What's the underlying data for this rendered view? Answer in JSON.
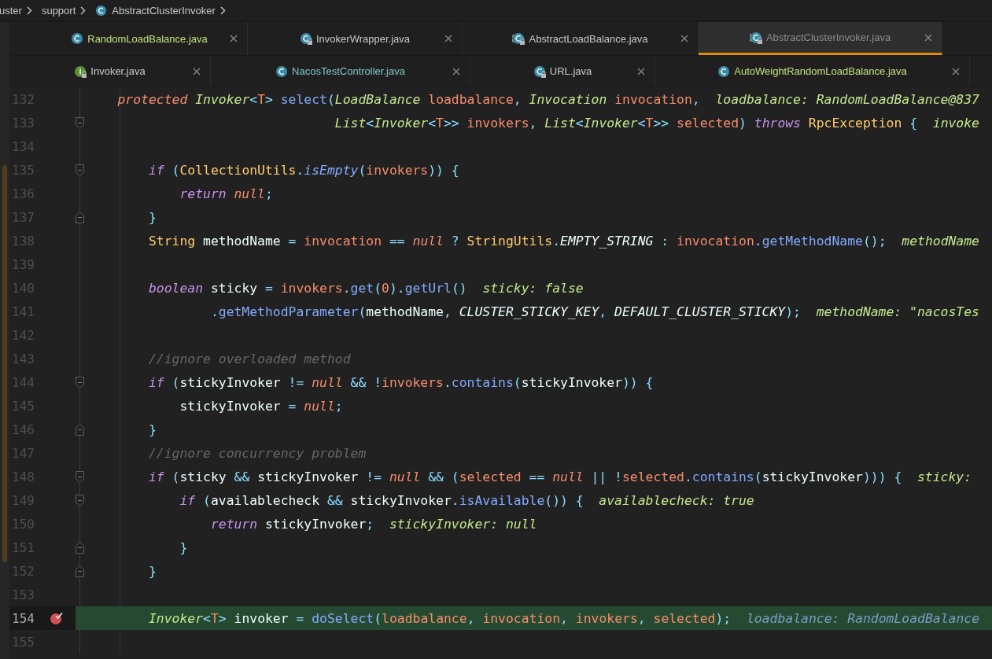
{
  "breadcrumbs": [
    {
      "label": "uster"
    },
    {
      "label": "support"
    },
    {
      "label": "AbstractClusterInvoker",
      "kind": "class"
    }
  ],
  "tab_rows": [
    [
      {
        "label": "RandomLoadBalance.java",
        "kind": "class",
        "locked": false,
        "selected": false,
        "color": "#c5e07c"
      },
      {
        "label": "InvokerWrapper.java",
        "kind": "class",
        "locked": true,
        "selected": false,
        "color": "#c9c9c9"
      },
      {
        "label": "AbstractLoadBalance.java",
        "kind": "abstract",
        "locked": true,
        "selected": false,
        "color": "#c9c9c9"
      },
      {
        "label": "AbstractClusterInvoker.java",
        "kind": "abstract",
        "locked": true,
        "selected": true,
        "color": "#8c8c8c"
      }
    ],
    [
      {
        "label": "Invoker.java",
        "kind": "interface",
        "locked": true,
        "selected": false,
        "color": "#c9c9c9"
      },
      {
        "label": "NacosTestController.java",
        "kind": "class",
        "locked": false,
        "selected": false,
        "color": "#7fc6c6"
      },
      {
        "label": "URL.java",
        "kind": "class",
        "locked": true,
        "selected": false,
        "color": "#c9c9c9"
      },
      {
        "label": "AutoWeightRandomLoadBalance.java",
        "kind": "class",
        "locked": false,
        "selected": false,
        "color": "#c5e07c"
      }
    ]
  ],
  "editor": {
    "lines": [
      {
        "number": "132",
        "current": false,
        "breakpoint": false,
        "code": [
          {
            "kind": "modifier",
            "text": "    protected "
          },
          {
            "kind": "type",
            "text": "Invoker"
          },
          {
            "kind": "punct",
            "text": "<"
          },
          {
            "kind": "type_param",
            "text": "T"
          },
          {
            "kind": "punct",
            "text": "> "
          },
          {
            "kind": "method",
            "text": "select"
          },
          {
            "kind": "punct",
            "text": "("
          },
          {
            "kind": "type",
            "text": "LoadBalance "
          },
          {
            "kind": "param",
            "text": "loadbalance"
          },
          {
            "kind": "punct",
            "text": ", "
          },
          {
            "kind": "type",
            "text": "Invocation "
          },
          {
            "kind": "param",
            "text": "invocation"
          },
          {
            "kind": "punct",
            "text": ","
          }
        ],
        "hint": "loadbalance: RandomLoadBalance@837"
      },
      {
        "number": "133",
        "kind": "fold_start",
        "current": false,
        "breakpoint": false,
        "code": [
          {
            "kind": "type",
            "text": "                                List"
          },
          {
            "kind": "punct",
            "text": "<"
          },
          {
            "kind": "type",
            "text": "Invoker"
          },
          {
            "kind": "punct",
            "text": "<"
          },
          {
            "kind": "type_param",
            "text": "T"
          },
          {
            "kind": "punct",
            "text": ">> "
          },
          {
            "kind": "param",
            "text": "invokers"
          },
          {
            "kind": "punct",
            "text": ", "
          },
          {
            "kind": "type",
            "text": "List"
          },
          {
            "kind": "punct",
            "text": "<"
          },
          {
            "kind": "type",
            "text": "Invoker"
          },
          {
            "kind": "punct",
            "text": "<"
          },
          {
            "kind": "type_param",
            "text": "T"
          },
          {
            "kind": "punct",
            "text": ">> "
          },
          {
            "kind": "param",
            "text": "selected"
          },
          {
            "kind": "punct",
            "text": ") "
          },
          {
            "kind": "keyword",
            "text": "throws "
          },
          {
            "kind": "class",
            "text": "RpcException "
          },
          {
            "kind": "punct",
            "text": "{"
          }
        ],
        "hint": "invoke"
      },
      {
        "number": "134",
        "current": false,
        "breakpoint": false
      },
      {
        "number": "135",
        "kind": "fold_start",
        "current": false,
        "breakpoint": false,
        "code": [
          {
            "kind": "keyword",
            "text": "        if "
          },
          {
            "kind": "punct",
            "text": "("
          },
          {
            "kind": "class",
            "text": "CollectionUtils"
          },
          {
            "kind": "punct",
            "text": "."
          },
          {
            "kind": "static_method",
            "text": "isEmpty"
          },
          {
            "kind": "punct",
            "text": "("
          },
          {
            "kind": "param",
            "text": "invokers"
          },
          {
            "kind": "punct",
            "text": ")) {"
          }
        ]
      },
      {
        "number": "136",
        "current": false,
        "breakpoint": false,
        "code": [
          {
            "kind": "keyword",
            "text": "            return "
          },
          {
            "kind": "literal",
            "text": "null"
          },
          {
            "kind": "punct",
            "text": ";"
          }
        ]
      },
      {
        "number": "137",
        "kind": "fold_end",
        "current": false,
        "breakpoint": false,
        "code": [
          {
            "kind": "punct",
            "text": "        }"
          }
        ]
      },
      {
        "number": "138",
        "current": false,
        "breakpoint": false,
        "code": [
          {
            "kind": "class",
            "text": "        String "
          },
          {
            "kind": "ident",
            "text": "methodName "
          },
          {
            "kind": "punct",
            "text": "= "
          },
          {
            "kind": "param",
            "text": "invocation "
          },
          {
            "kind": "punct",
            "text": "== "
          },
          {
            "kind": "literal",
            "text": "null "
          },
          {
            "kind": "punct",
            "text": "? "
          },
          {
            "kind": "class",
            "text": "StringUtils"
          },
          {
            "kind": "punct",
            "text": "."
          },
          {
            "kind": "constant",
            "text": "EMPTY_STRING "
          },
          {
            "kind": "punct",
            "text": ": "
          },
          {
            "kind": "param",
            "text": "invocation"
          },
          {
            "kind": "punct",
            "text": "."
          },
          {
            "kind": "method",
            "text": "getMethodName"
          },
          {
            "kind": "punct",
            "text": "();"
          }
        ],
        "hint": "methodName"
      },
      {
        "number": "139",
        "current": false,
        "breakpoint": false
      },
      {
        "number": "140",
        "current": false,
        "breakpoint": false,
        "code": [
          {
            "kind": "keyword",
            "text": "        boolean "
          },
          {
            "kind": "ident",
            "text": "sticky "
          },
          {
            "kind": "punct",
            "text": "= "
          },
          {
            "kind": "param",
            "text": "invokers"
          },
          {
            "kind": "punct",
            "text": "."
          },
          {
            "kind": "method",
            "text": "get"
          },
          {
            "kind": "punct",
            "text": "("
          },
          {
            "kind": "number",
            "text": "0"
          },
          {
            "kind": "punct",
            "text": ")."
          },
          {
            "kind": "method",
            "text": "getUrl"
          },
          {
            "kind": "punct",
            "text": "()"
          }
        ],
        "hint": "sticky: false"
      },
      {
        "number": "141",
        "current": false,
        "breakpoint": false,
        "code": [
          {
            "kind": "punct",
            "text": "                ."
          },
          {
            "kind": "method",
            "text": "getMethodParameter"
          },
          {
            "kind": "punct",
            "text": "("
          },
          {
            "kind": "ident",
            "text": "methodName"
          },
          {
            "kind": "punct",
            "text": ", "
          },
          {
            "kind": "constant",
            "text": "CLUSTER_STICKY_KEY"
          },
          {
            "kind": "punct",
            "text": ", "
          },
          {
            "kind": "constant",
            "text": "DEFAULT_CLUSTER_STICKY"
          },
          {
            "kind": "punct",
            "text": ");"
          }
        ],
        "hint": "methodName: \"nacosTes"
      },
      {
        "number": "142",
        "current": false,
        "breakpoint": false
      },
      {
        "number": "143",
        "current": false,
        "breakpoint": false,
        "code": [
          {
            "kind": "comment",
            "text": "        //ignore overloaded method"
          }
        ]
      },
      {
        "number": "144",
        "kind": "fold_start",
        "current": false,
        "breakpoint": false,
        "code": [
          {
            "kind": "keyword",
            "text": "        if "
          },
          {
            "kind": "punct",
            "text": "("
          },
          {
            "kind": "ident",
            "text": "stickyInvoker "
          },
          {
            "kind": "punct",
            "text": "!= "
          },
          {
            "kind": "literal",
            "text": "null "
          },
          {
            "kind": "punct",
            "text": "&& !"
          },
          {
            "kind": "param",
            "text": "invokers"
          },
          {
            "kind": "punct",
            "text": "."
          },
          {
            "kind": "method",
            "text": "contains"
          },
          {
            "kind": "punct",
            "text": "("
          },
          {
            "kind": "ident",
            "text": "stickyInvoker"
          },
          {
            "kind": "punct",
            "text": ")) {"
          }
        ]
      },
      {
        "number": "145",
        "current": false,
        "breakpoint": false,
        "code": [
          {
            "kind": "ident",
            "text": "            stickyInvoker "
          },
          {
            "kind": "punct",
            "text": "= "
          },
          {
            "kind": "literal",
            "text": "null"
          },
          {
            "kind": "punct",
            "text": ";"
          }
        ]
      },
      {
        "number": "146",
        "kind": "fold_end",
        "current": false,
        "breakpoint": false,
        "code": [
          {
            "kind": "punct",
            "text": "        }"
          }
        ]
      },
      {
        "number": "147",
        "current": false,
        "breakpoint": false,
        "code": [
          {
            "kind": "comment",
            "text": "        //ignore concurrency problem"
          }
        ]
      },
      {
        "number": "148",
        "kind": "fold_start",
        "current": false,
        "breakpoint": false,
        "code": [
          {
            "kind": "keyword",
            "text": "        if "
          },
          {
            "kind": "punct",
            "text": "("
          },
          {
            "kind": "ident",
            "text": "sticky "
          },
          {
            "kind": "punct",
            "text": "&& "
          },
          {
            "kind": "ident",
            "text": "stickyInvoker "
          },
          {
            "kind": "punct",
            "text": "!= "
          },
          {
            "kind": "literal",
            "text": "null "
          },
          {
            "kind": "punct",
            "text": "&& ("
          },
          {
            "kind": "param",
            "text": "selected "
          },
          {
            "kind": "punct",
            "text": "== "
          },
          {
            "kind": "literal",
            "text": "null "
          },
          {
            "kind": "punct",
            "text": "|| !"
          },
          {
            "kind": "param",
            "text": "selected"
          },
          {
            "kind": "punct",
            "text": "."
          },
          {
            "kind": "method",
            "text": "contains"
          },
          {
            "kind": "punct",
            "text": "("
          },
          {
            "kind": "ident",
            "text": "stickyInvoker"
          },
          {
            "kind": "punct",
            "text": "))) {"
          }
        ],
        "hint": "sticky:"
      },
      {
        "number": "149",
        "kind": "fold_start",
        "current": false,
        "breakpoint": false,
        "code": [
          {
            "kind": "keyword",
            "text": "            if "
          },
          {
            "kind": "punct",
            "text": "("
          },
          {
            "kind": "ident",
            "text": "availablecheck "
          },
          {
            "kind": "punct",
            "text": "&& "
          },
          {
            "kind": "ident",
            "text": "stickyInvoker"
          },
          {
            "kind": "punct",
            "text": "."
          },
          {
            "kind": "method",
            "text": "isAvailable"
          },
          {
            "kind": "punct",
            "text": "()) {"
          }
        ],
        "hint": "availablecheck: true"
      },
      {
        "number": "150",
        "current": false,
        "breakpoint": false,
        "code": [
          {
            "kind": "keyword",
            "text": "                return "
          },
          {
            "kind": "ident",
            "text": "stickyInvoker"
          },
          {
            "kind": "punct",
            "text": ";"
          }
        ],
        "hint": "stickyInvoker: null"
      },
      {
        "number": "151",
        "kind": "fold_end",
        "current": false,
        "breakpoint": false,
        "code": [
          {
            "kind": "punct",
            "text": "            }"
          }
        ]
      },
      {
        "number": "152",
        "kind": "fold_end",
        "current": false,
        "breakpoint": false,
        "code": [
          {
            "kind": "punct",
            "text": "        }"
          }
        ]
      },
      {
        "number": "153",
        "current": false,
        "breakpoint": false
      },
      {
        "number": "154",
        "current": true,
        "breakpoint": true,
        "code": [
          {
            "kind": "type",
            "text": "        Invoker"
          },
          {
            "kind": "punct",
            "text": "<"
          },
          {
            "kind": "type_param",
            "text": "T"
          },
          {
            "kind": "punct",
            "text": "> "
          },
          {
            "kind": "ident",
            "text": "invoker "
          },
          {
            "kind": "punct",
            "text": "= "
          },
          {
            "kind": "method",
            "text": "doSelect"
          },
          {
            "kind": "punct",
            "text": "("
          },
          {
            "kind": "param",
            "text": "loadbalance"
          },
          {
            "kind": "punct",
            "text": ", "
          },
          {
            "kind": "param",
            "text": "invocation"
          },
          {
            "kind": "punct",
            "text": ", "
          },
          {
            "kind": "param",
            "text": "invokers"
          },
          {
            "kind": "punct",
            "text": ", "
          },
          {
            "kind": "param",
            "text": "selected"
          },
          {
            "kind": "punct",
            "text": ");"
          }
        ],
        "hint": "loadbalance: RandomLoadBalance"
      },
      {
        "number": "155",
        "current": false,
        "breakpoint": false
      }
    ]
  }
}
